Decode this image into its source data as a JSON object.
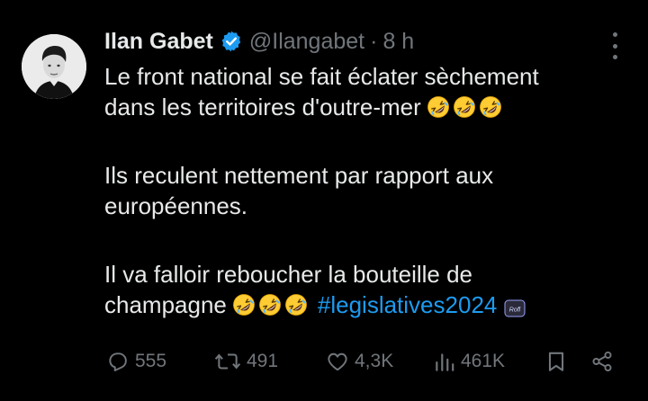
{
  "tweet": {
    "author": {
      "name": "Ilan Gabet",
      "handle": "@Ilangabet",
      "separator": "·",
      "time": "8 h"
    },
    "lines": [
      "Le front national se fait éclater sèchement",
      "dans les territoires d'outre-mer",
      "Ils reculent nettement par rapport aux",
      "européennes.",
      "Il va falloir reboucher la bouteille de",
      "champagne"
    ],
    "emoji_name": "rolling-on-the-floor-laughing",
    "hashtag": "#legislatives2024",
    "sticker_text": "Rofl",
    "actions": {
      "replies": "555",
      "reposts": "491",
      "likes": "4,3K",
      "views": "461K"
    }
  },
  "colors": {
    "background": "#000000",
    "text": "#e7e9ea",
    "muted": "#71767b",
    "accent": "#1d9bf0"
  },
  "icons": [
    "verified-badge-icon",
    "more-icon",
    "reply-icon",
    "repost-icon",
    "like-icon",
    "views-icon",
    "bookmark-icon",
    "share-icon"
  ]
}
